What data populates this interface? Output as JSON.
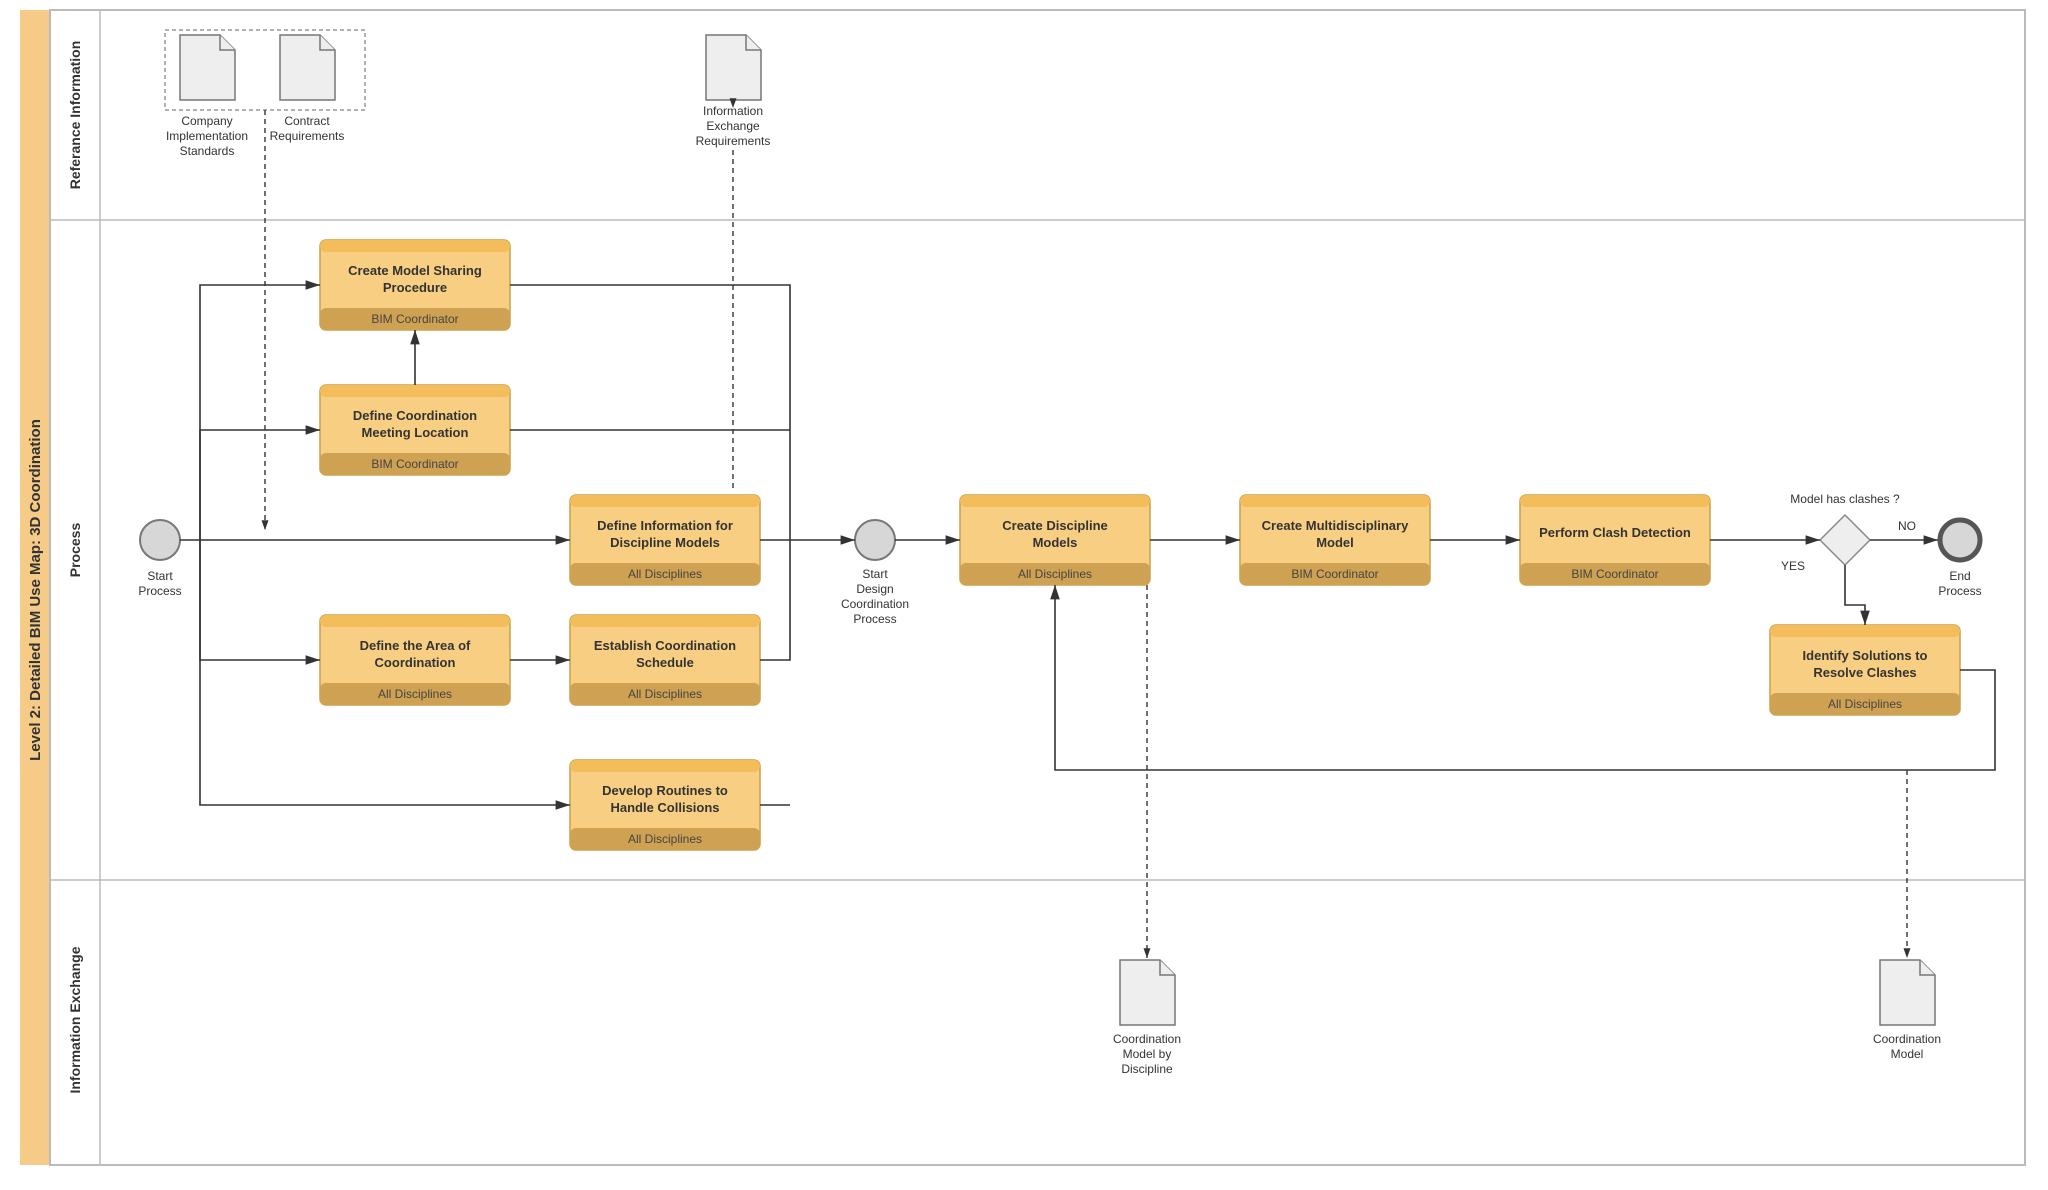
{
  "swimlane": {
    "mainTitle": "Level 2: Detailed BIM Use Map: 3D Coordination",
    "lane1": "Referance Information",
    "lane2": "Process",
    "lane3": "Information Exchange"
  },
  "docs": {
    "companyStd1": "Company",
    "companyStd2": "Implementation",
    "companyStd3": "Standards",
    "contractReq1": "Contract",
    "contractReq2": "Requirements",
    "infoExReq1": "Information",
    "infoExReq2": "Exchange",
    "infoExReq3": "Requirements",
    "coordByDisc1": "Coordination",
    "coordByDisc2": "Model by",
    "coordByDisc3": "Discipline",
    "coordModel1": "Coordination",
    "coordModel2": "Model"
  },
  "events": {
    "start1a": "Start",
    "start1b": "Process",
    "start2a": "Start",
    "start2b": "Design",
    "start2c": "Coordination",
    "start2d": "Process",
    "end1a": "End",
    "end1b": "Process"
  },
  "gateway": {
    "question": "Model has clashes ?",
    "yes": "YES",
    "no": "NO"
  },
  "tasks": {
    "t1": {
      "l1": "Create Model Sharing",
      "l2": "Procedure",
      "role": "BIM Coordinator"
    },
    "t2": {
      "l1": "Define Coordination",
      "l2": "Meeting Location",
      "role": "BIM Coordinator"
    },
    "t3": {
      "l1": "Define Information for",
      "l2": "Discipline Models",
      "role": "All Disciplines"
    },
    "t4": {
      "l1": "Define the Area of",
      "l2": "Coordination",
      "role": "All Disciplines"
    },
    "t5": {
      "l1": "Establish Coordination",
      "l2": "Schedule",
      "role": "All Disciplines"
    },
    "t6": {
      "l1": "Develop Routines to",
      "l2": "Handle Collisions",
      "role": "All Disciplines"
    },
    "t7": {
      "l1": "Create Discipline",
      "l2": "Models",
      "role": "All Disciplines"
    },
    "t8": {
      "l1": "Create Multidisciplinary",
      "l2": "Model",
      "role": "BIM Coordinator"
    },
    "t9": {
      "l1": "Perform Clash Detection",
      "l2": "",
      "role": "BIM Coordinator"
    },
    "t10": {
      "l1": "Identify Solutions to",
      "l2": "Resolve Clashes",
      "role": "All Disciplines"
    }
  }
}
